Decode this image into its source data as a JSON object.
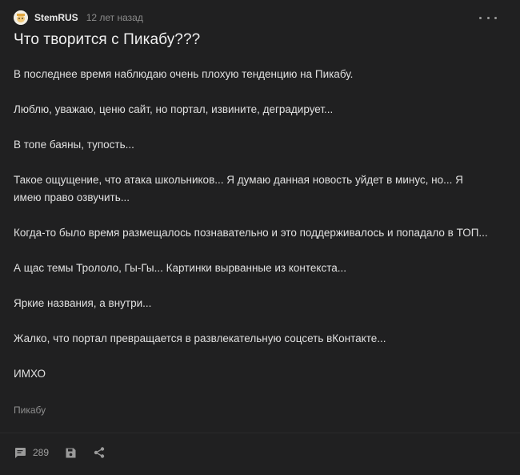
{
  "post": {
    "author": "StemRUS",
    "time": "12 лет назад",
    "title": "Что творится с Пикабу???",
    "paragraphs": [
      "В последнее время наблюдаю очень плохую тенденцию на Пикабу.",
      "Люблю, уважаю, ценю сайт, но портал, извините, деградирует...",
      "В топе баяны, тупость...",
      "Такое ощущение, что атака школьников... Я думаю данная новость уйдет в минус, но... Я имею право озвучить...",
      "Когда-то было время размещалось познавательно и это поддерживалось и попадало в ТОП...",
      "А щас темы Трололо, Гы-Гы... Картинки вырванные из контекста...",
      "Яркие названия, а внутри...",
      "Жалко, что портал превращается в развлекательную соцсеть вКонтакте...",
      "ИМХО"
    ],
    "tag": "Пикабу",
    "comments_count": "289"
  },
  "icons": {
    "avatar": "avatar-icon",
    "more": "more-options-icon",
    "comments": "comment-icon",
    "save": "save-icon",
    "share": "share-icon"
  }
}
